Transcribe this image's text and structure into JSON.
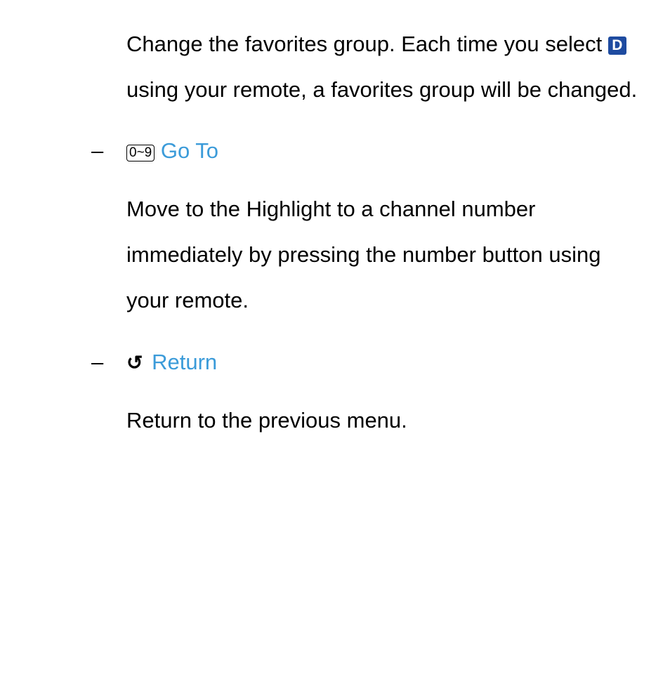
{
  "favorites": {
    "text_before": "Change the favorites group. Each time you select ",
    "button": "D",
    "text_after": " using your remote, a favorites group will be changed."
  },
  "goto": {
    "icon": "0~9",
    "label": "Go To",
    "desc": "Move to the Highlight to a channel number immediately by pressing the number button using your remote."
  },
  "ret": {
    "label": "Return",
    "desc": "Return to the previous menu."
  }
}
